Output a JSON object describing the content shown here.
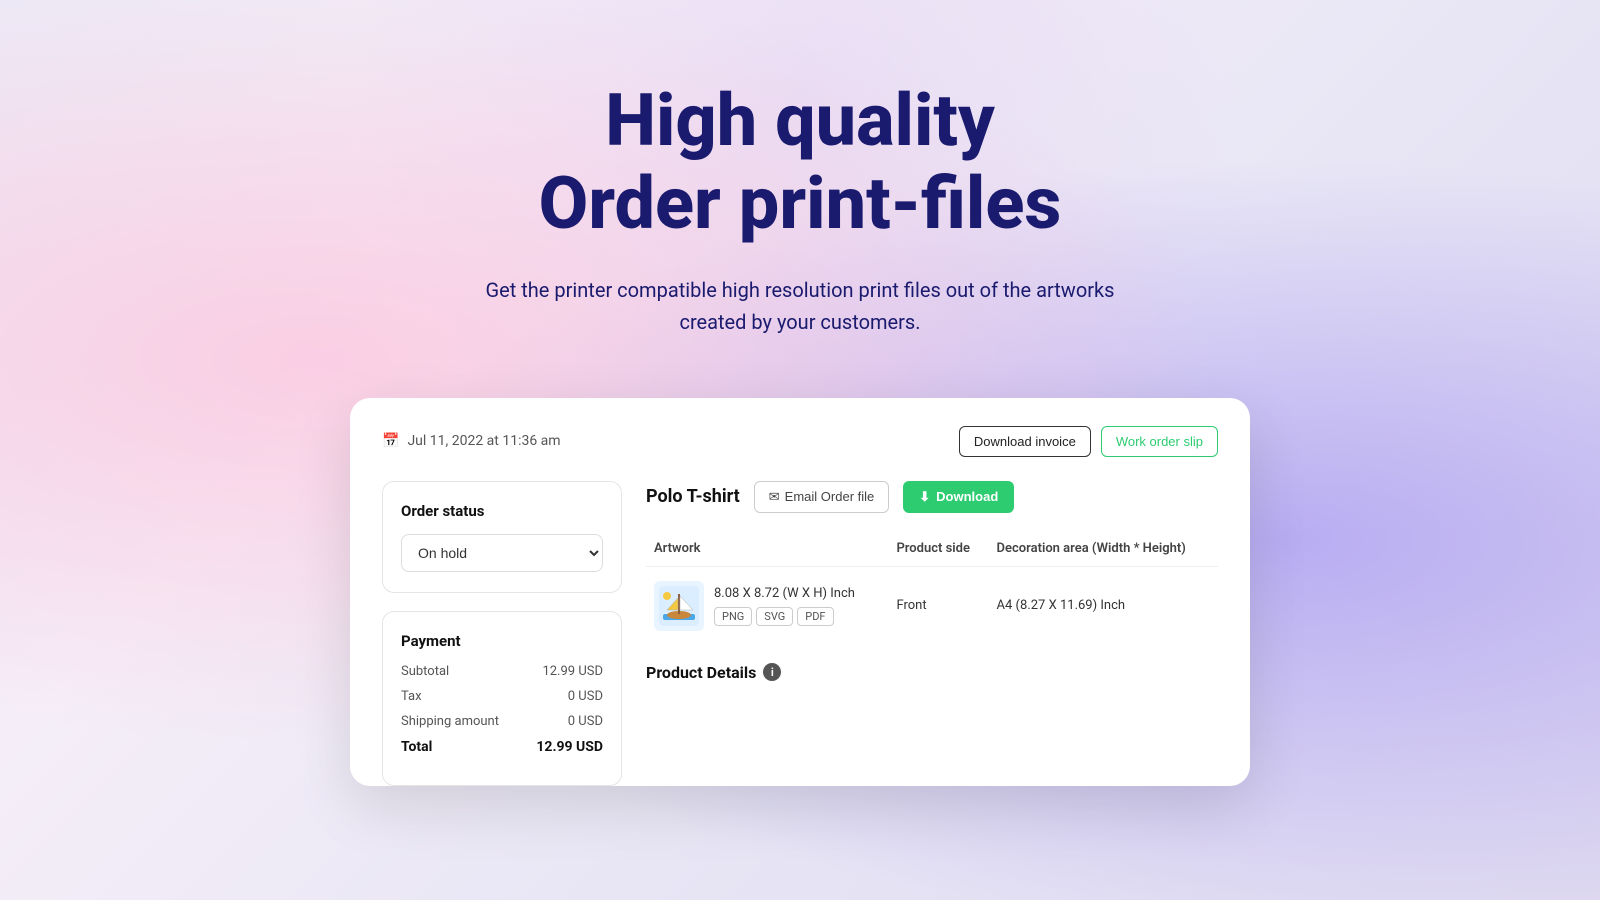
{
  "hero": {
    "title_line1": "High quality",
    "title_line2": "Order print-files",
    "subtitle": "Get the printer compatible high resolution print files out of the artworks created by your customers."
  },
  "card": {
    "date": "Jul 11, 2022 at 11:36 am",
    "actions": {
      "download_invoice": "Download invoice",
      "work_order_slip": "Work order slip"
    },
    "order_status": {
      "label": "Order status",
      "value": "On hold"
    },
    "payment": {
      "label": "Payment",
      "subtotal_label": "Subtotal",
      "subtotal_value": "12.99 USD",
      "tax_label": "Tax",
      "tax_value": "0 USD",
      "shipping_label": "Shipping amount",
      "shipping_value": "0 USD",
      "total_label": "Total",
      "total_value": "12.99 USD"
    },
    "product": {
      "name": "Polo T-shirt",
      "email_btn": "Email Order file",
      "download_btn": "Download",
      "table": {
        "headers": [
          "Artwork",
          "Product side",
          "Decoration area (Width * Height)"
        ],
        "rows": [
          {
            "size": "8.08 X 8.72 (W X H) Inch",
            "formats": [
              "PNG",
              "SVG",
              "PDF"
            ],
            "side": "Front",
            "decoration": "A4 (8.27 X 11.69) Inch"
          }
        ]
      },
      "product_details_label": "Product Details"
    }
  }
}
